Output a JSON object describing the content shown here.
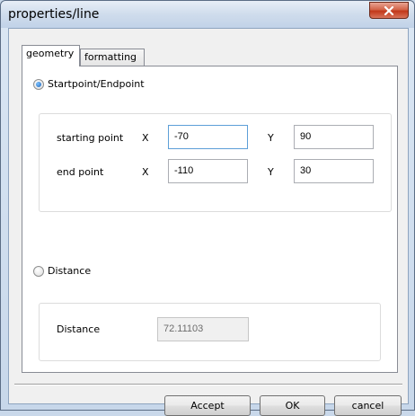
{
  "window": {
    "title": "properties/line",
    "close_icon": "close-icon"
  },
  "tabs": [
    {
      "label": "geometry",
      "active": true
    },
    {
      "label": "formatting",
      "active": false
    }
  ],
  "startpoint_mode": {
    "label": "Startpoint/Endpoint",
    "selected": true,
    "starting_point": {
      "label": "starting point",
      "x_label": "X",
      "x_value": "-70",
      "y_label": "Y",
      "y_value": "90"
    },
    "end_point": {
      "label": "end point",
      "x_label": "X",
      "x_value": "-110",
      "y_label": "Y",
      "y_value": "30"
    }
  },
  "distance_mode": {
    "label": "Distance",
    "selected": false,
    "distance_label": "Distance",
    "distance_value": "72.11103"
  },
  "buttons": {
    "accept": "Accept",
    "ok": "OK",
    "cancel": "cancel"
  },
  "colors": {
    "close_button": "#c2381a",
    "window_frame": "#c7d7ea"
  }
}
